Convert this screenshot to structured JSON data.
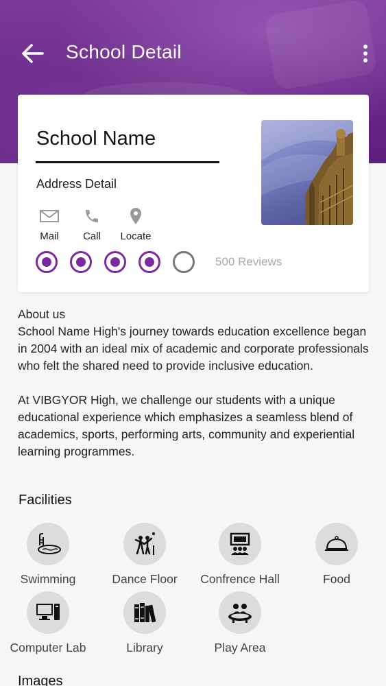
{
  "header": {
    "title": "School Detail",
    "back_icon": "arrow-left-icon",
    "menu_icon": "more-vertical-icon",
    "accent_color": "#6b2a8a"
  },
  "school": {
    "name": "School Name",
    "address": "Address Detail",
    "actions": [
      {
        "label": "Mail",
        "icon": "mail-icon"
      },
      {
        "label": "Call",
        "icon": "phone-icon"
      },
      {
        "label": "Locate",
        "icon": "location-pin-icon"
      }
    ],
    "rating": 4,
    "rating_max": 5,
    "reviews": "500 Reviews",
    "rating_color": "#7a2aa0"
  },
  "about": {
    "heading": "About us",
    "paragraph1": "School Name High's journey towards education excellence began in 2004 with an ideal mix of academic and corporate professionals who felt the shared need to provide inclusive education.",
    "paragraph2": "At VIBGYOR High, we challenge our students with a unique educational experience which emphasizes a seamless blend of academics, sports, performing arts, community and experiential learning programmes."
  },
  "facilities": {
    "title": "Facilities",
    "items": [
      {
        "label": "Swimming",
        "icon": "swimming-pool-icon"
      },
      {
        "label": "Dance Floor",
        "icon": "dance-icon"
      },
      {
        "label": "Confrence Hall",
        "icon": "conference-icon"
      },
      {
        "label": "Food",
        "icon": "food-cloche-icon"
      },
      {
        "label": "Computer Lab",
        "icon": "computer-icon"
      },
      {
        "label": "Library",
        "icon": "books-icon"
      },
      {
        "label": "Play Area",
        "icon": "play-area-icon"
      }
    ]
  },
  "images": {
    "title": "Images"
  }
}
